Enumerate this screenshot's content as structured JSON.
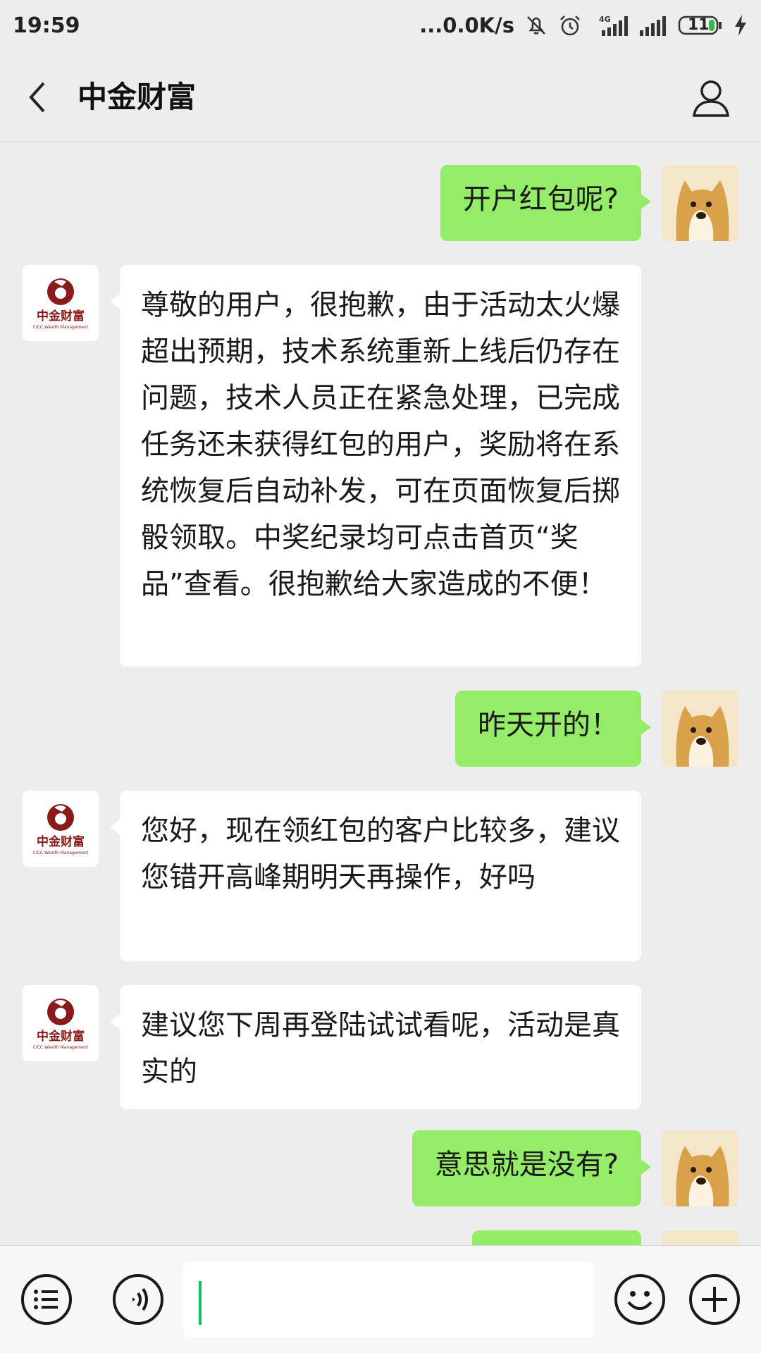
{
  "status_bar": {
    "time": "19:59",
    "network_speed": "...0.0K/s",
    "network_type": "4G",
    "battery_level": "11",
    "icons": [
      "mute-icon",
      "alarm-icon",
      "signal-4g-icon",
      "signal-icon",
      "battery-icon",
      "charging-icon"
    ]
  },
  "header": {
    "title": "中金财富",
    "back_icon": "chevron-left-icon",
    "profile_icon": "person-icon"
  },
  "bot_logo": {
    "name": "中金财富",
    "subtitle": "CICC Wealth Management"
  },
  "messages": [
    {
      "sender": "me",
      "text": "开户红包呢?"
    },
    {
      "sender": "bot",
      "text": "尊敬的用户，很抱歉，由于活动太火爆超出预期，技术系统重新上线后仍存在问题，技术人员正在紧急处理，已完成任务还未获得红包的用户，奖励将在系统恢复后自动补发，可在页面恢复后掷骰领取。中奖纪录均可点击首页“奖品”查看。很抱歉给大家造成的不便！"
    },
    {
      "sender": "me",
      "text": "昨天开的！"
    },
    {
      "sender": "bot",
      "text": "您好，现在领红包的客户比较多，建议您错开高峰期明天再操作，好吗"
    },
    {
      "sender": "bot",
      "text": "建议您下周再登陆试试看呢，活动是真实的"
    },
    {
      "sender": "me",
      "text": "意思就是没有?"
    },
    {
      "sender": "me",
      "text": ""
    }
  ],
  "input_bar": {
    "menu_icon": "menu-list-icon",
    "voice_icon": "voice-icon",
    "input_value": "",
    "emoji_icon": "emoji-icon",
    "add_icon": "plus-circle-icon"
  },
  "colors": {
    "my_bubble": "#95ec69",
    "bot_bubble": "#ffffff",
    "background": "#ededed",
    "logo_red": "#8b1a1a",
    "caret": "#07c160"
  }
}
